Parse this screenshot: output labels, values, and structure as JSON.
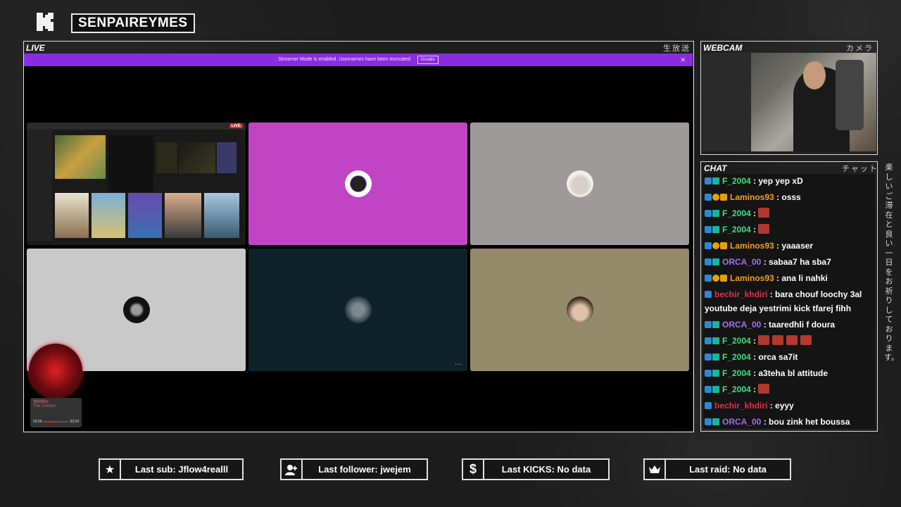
{
  "header": {
    "channel_name": "SENPAIREYMES"
  },
  "live_panel": {
    "label": "LIVE",
    "jp": "生放送",
    "banner_text": "Streamer Mode is enabled. Usernames have been truncated.",
    "banner_button": "Disable",
    "live_badge": "LIVE",
    "tile_colors": [
      "#1a1a1a",
      "#c144c4",
      "#9f9a9a",
      "#c9c9c9",
      "#0e2329",
      "#958a6b"
    ],
    "more_label": "···"
  },
  "music": {
    "title": "Wildfire",
    "artist": "The Chosen",
    "elapsed": "03:09",
    "remaining": "03:29",
    "progress": 0.5
  },
  "webcam_panel": {
    "label": "WEBCAM",
    "jp": "カメラ"
  },
  "chat_panel": {
    "label": "CHAT",
    "jp": "チャット",
    "messages": [
      {
        "user": "F_2004",
        "color": "#3ee07a",
        "text": "yep yep xD",
        "badges": [
          "kick",
          "sub"
        ],
        "emotes": 0
      },
      {
        "user": "Laminos93",
        "color": "#f0a020",
        "text": "osss",
        "badges": [
          "kick",
          "one",
          "crown"
        ],
        "emotes": 0
      },
      {
        "user": "F_2004",
        "color": "#3ee07a",
        "text": "",
        "badges": [
          "kick",
          "sub"
        ],
        "emotes": 1
      },
      {
        "user": "F_2004",
        "color": "#3ee07a",
        "text": "",
        "badges": [
          "kick",
          "sub"
        ],
        "emotes": 1
      },
      {
        "user": "Laminos93",
        "color": "#f0a020",
        "text": "yaaaser",
        "badges": [
          "kick",
          "one",
          "crown"
        ],
        "emotes": 0
      },
      {
        "user": "ORCA_00",
        "color": "#a76cf0",
        "text": "sabaa7 ha sba7",
        "badges": [
          "kick",
          "sub"
        ],
        "emotes": 0
      },
      {
        "user": "Laminos93",
        "color": "#f0a020",
        "text": "ana li nahki",
        "badges": [
          "kick",
          "one",
          "crown"
        ],
        "emotes": 0
      },
      {
        "user": "bechir_khdiri",
        "color": "#e0304a",
        "text": "bara chouf loochy 3al youtube deja yestrimi kick tfarej fihh",
        "badges": [
          "kick"
        ],
        "emotes": 0
      },
      {
        "user": "ORCA_00",
        "color": "#a76cf0",
        "text": "taaredhli f doura",
        "badges": [
          "kick",
          "sub"
        ],
        "emotes": 0
      },
      {
        "user": "F_2004",
        "color": "#3ee07a",
        "text": "",
        "badges": [
          "kick",
          "sub"
        ],
        "emotes": 4
      },
      {
        "user": "F_2004",
        "color": "#3ee07a",
        "text": "orca sa7it",
        "badges": [
          "kick",
          "sub"
        ],
        "emotes": 0
      },
      {
        "user": "F_2004",
        "color": "#3ee07a",
        "text": "a3teha bl attitude",
        "badges": [
          "kick",
          "sub"
        ],
        "emotes": 0
      },
      {
        "user": "F_2004",
        "color": "#3ee07a",
        "text": "",
        "badges": [
          "kick",
          "sub"
        ],
        "emotes": 1
      },
      {
        "user": "bechir_khdiri",
        "color": "#e0304a",
        "text": "eyyy",
        "badges": [
          "kick"
        ],
        "emotes": 0
      },
      {
        "user": "ORCA_00",
        "color": "#a76cf0",
        "text": "bou zink het boussa",
        "badges": [
          "kick",
          "sub"
        ],
        "emotes": 0
      }
    ]
  },
  "side_text": "楽しいご滞在と良い一日をお祈りしております。",
  "stats": [
    {
      "icon": "star-icon",
      "text": "Last sub: Jflow4realll"
    },
    {
      "icon": "user-plus-icon",
      "text": "Last follower: jwejem"
    },
    {
      "icon": "dollar-icon",
      "text": "Last KICKS: No data"
    },
    {
      "icon": "crown-icon",
      "text": "Last raid: No data"
    }
  ]
}
